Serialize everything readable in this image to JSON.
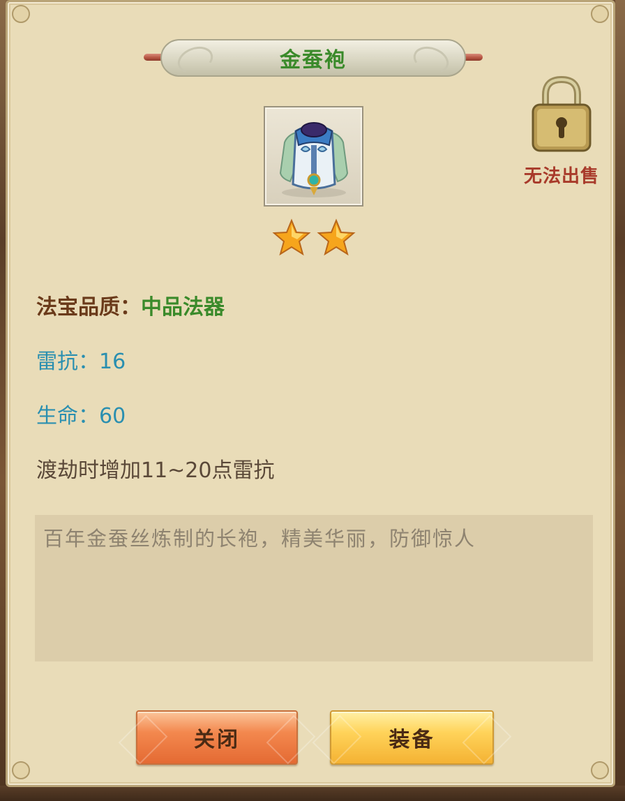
{
  "item": {
    "name": "金蚕袍",
    "icon": "silkworm-robe-icon",
    "stars": 2
  },
  "sell_status": {
    "label": "无法出售",
    "icon": "lock-icon"
  },
  "attributes": {
    "quality_label": "法宝品质：",
    "quality_value": "中品法器",
    "thunder_resist": "雷抗：16",
    "life": "生命：60",
    "effect": "渡劫时增加11~20点雷抗"
  },
  "description": "百年金蚕丝炼制的长袍，精美华丽，防御惊人",
  "buttons": {
    "close": "关闭",
    "equip": "装备"
  },
  "colors": {
    "title_green": "#3a8a2a",
    "quality_green": "#3a8a2a",
    "stat_blue": "#2a8fb0",
    "warning_red": "#a83a2a",
    "close_orange": "#f3884e",
    "equip_yellow": "#ffd35a"
  }
}
